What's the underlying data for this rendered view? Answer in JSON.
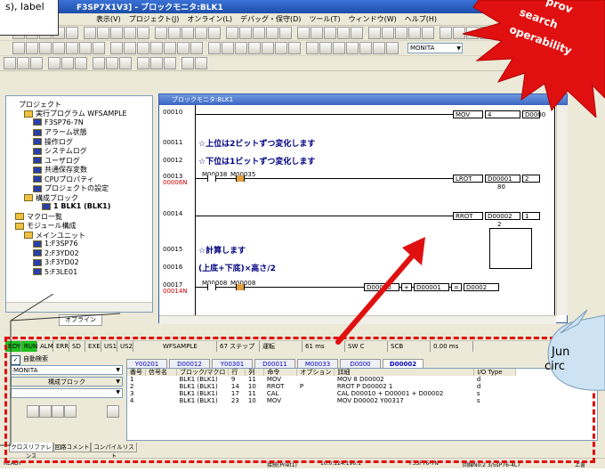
{
  "window": {
    "title": "F3SP7X1V3] - ブロックモニタ:BLK1",
    "doc_title": "ブロックモニタ:BLK1"
  },
  "menu": [
    "表示(V)",
    "プロジェクト(J)",
    "オンライン(L)",
    "デバッグ・保守(D)",
    "ツール(T)",
    "ウィンドウ(W)",
    "ヘルプ(H)"
  ],
  "toolbar": {
    "combo_value": "MONITA"
  },
  "project_tree": {
    "title": "プロジェクト",
    "items": [
      {
        "label": "実行プログラム WFSAMPLE",
        "indent": 1
      },
      {
        "label": "F3SP76-7N",
        "indent": 2
      },
      {
        "label": "アラーム状態",
        "indent": 2
      },
      {
        "label": "操作ログ",
        "indent": 2
      },
      {
        "label": "システムログ",
        "indent": 2
      },
      {
        "label": "ユーザログ",
        "indent": 2
      },
      {
        "label": "共通保存変数",
        "indent": 2
      },
      {
        "label": "CPUプロパティ",
        "indent": 2
      },
      {
        "label": "プロジェクトの設定",
        "indent": 2
      },
      {
        "label": "構成ブロック",
        "indent": 1
      },
      {
        "label": "1 BLK1 (BLK1)",
        "indent": 3
      },
      {
        "label": "マクロ一覧",
        "indent": 0
      },
      {
        "label": "モジュール構成",
        "indent": 0
      },
      {
        "label": "メインユニット",
        "indent": 1
      },
      {
        "label": "1:F3SP76",
        "indent": 2
      },
      {
        "label": "2:F3YD02",
        "indent": 2
      },
      {
        "label": "3:F3YD02",
        "indent": 2
      },
      {
        "label": "5:F3LE01",
        "indent": 2
      }
    ],
    "tabs": [
      "オフライン"
    ]
  },
  "ladder": {
    "rows": [
      {
        "step": "00010",
        "type": "instr",
        "instr": [
          "MOV",
          "4",
          "D0000"
        ]
      },
      {
        "step": "00011",
        "type": "comment",
        "text": "☆上位は2ビットずつ変化します"
      },
      {
        "step": "00012",
        "type": "comment",
        "text": "☆下位は1ビットずつ変化します"
      },
      {
        "step": "00013",
        "type": "contacts",
        "extra": "00006N",
        "contacts": [
          "M00038",
          "M00035"
        ],
        "instr": [
          "LROT",
          "D00001",
          "2"
        ],
        "value": "80"
      },
      {
        "step": "00014",
        "type": "instr",
        "instr": [
          "RROT",
          "D00002",
          "1"
        ],
        "value": "2"
      },
      {
        "step": "00015",
        "type": "comment",
        "text": "☆計算します"
      },
      {
        "step": "00016",
        "type": "comment",
        "text": "(上底+下底)×高さ/2"
      },
      {
        "step": "00017",
        "type": "contacts",
        "extra": "00014N",
        "contacts": [
          "M00008",
          "M00008"
        ],
        "instr": [
          "D00010",
          "+",
          "D00001",
          "=",
          "D0002"
        ]
      }
    ]
  },
  "status_bar": [
    "RDY",
    "RUN",
    "ALM",
    "ERR",
    "SD",
    "EXE",
    "US1",
    "US2",
    "WFSAMPLE",
    "67 ステップ",
    "運転",
    "61 ms",
    "SW C",
    "SCB",
    "0.00 ms"
  ],
  "xref": {
    "auto_search_label": "自動検索",
    "search_value": "MONITA",
    "scope_label": "構成ブロック",
    "tabs": [
      "Y00201",
      "D00012",
      "Y00301",
      "D00011",
      "M00033",
      "D0000",
      "D00002"
    ],
    "columns": [
      "番号",
      "信号名",
      "ブロック/マクロ",
      "行",
      "列",
      "命令",
      "オプション",
      "詳細",
      "I/O Type"
    ],
    "rows": [
      [
        "1",
        "",
        "BLK1 (BLK1)",
        "9",
        "11",
        "MOV",
        "",
        "MOV 8 D00002",
        "d"
      ],
      [
        "2",
        "",
        "BLK1 (BLK1)",
        "14",
        "10",
        "RROT",
        "P",
        "RROT P D00002 1",
        "d"
      ],
      [
        "3",
        "",
        "BLK1 (BLK1)",
        "17",
        "11",
        "CAL",
        "",
        "CAL D00010 + D00001 + D00002",
        "s"
      ],
      [
        "4",
        "",
        "BLK1 (BLK1)",
        "23",
        "10",
        "MOV",
        "",
        "MOV D00002 Y00317",
        "s"
      ]
    ],
    "bottom_tabs": [
      "クロスリファレンス",
      "回路コメント",
      "コンパイルリスト"
    ]
  },
  "bottom_status": [
    "READY",
    "接続(Pnet1)",
    "10.0.124.196:1",
    "F3SP76-7N",
    "回線No:2 3/5sP76-4L7",
    "上書"
  ],
  "callouts": {
    "top_left": "s), label",
    "starburst": [
      "prov",
      "search",
      "operability"
    ],
    "bubble_right": [
      "Jun",
      "circ"
    ]
  },
  "colors": {
    "accent_red": "#e01010",
    "ladder_bg": "#ffffff",
    "title_bar": "#1e4ea8"
  }
}
